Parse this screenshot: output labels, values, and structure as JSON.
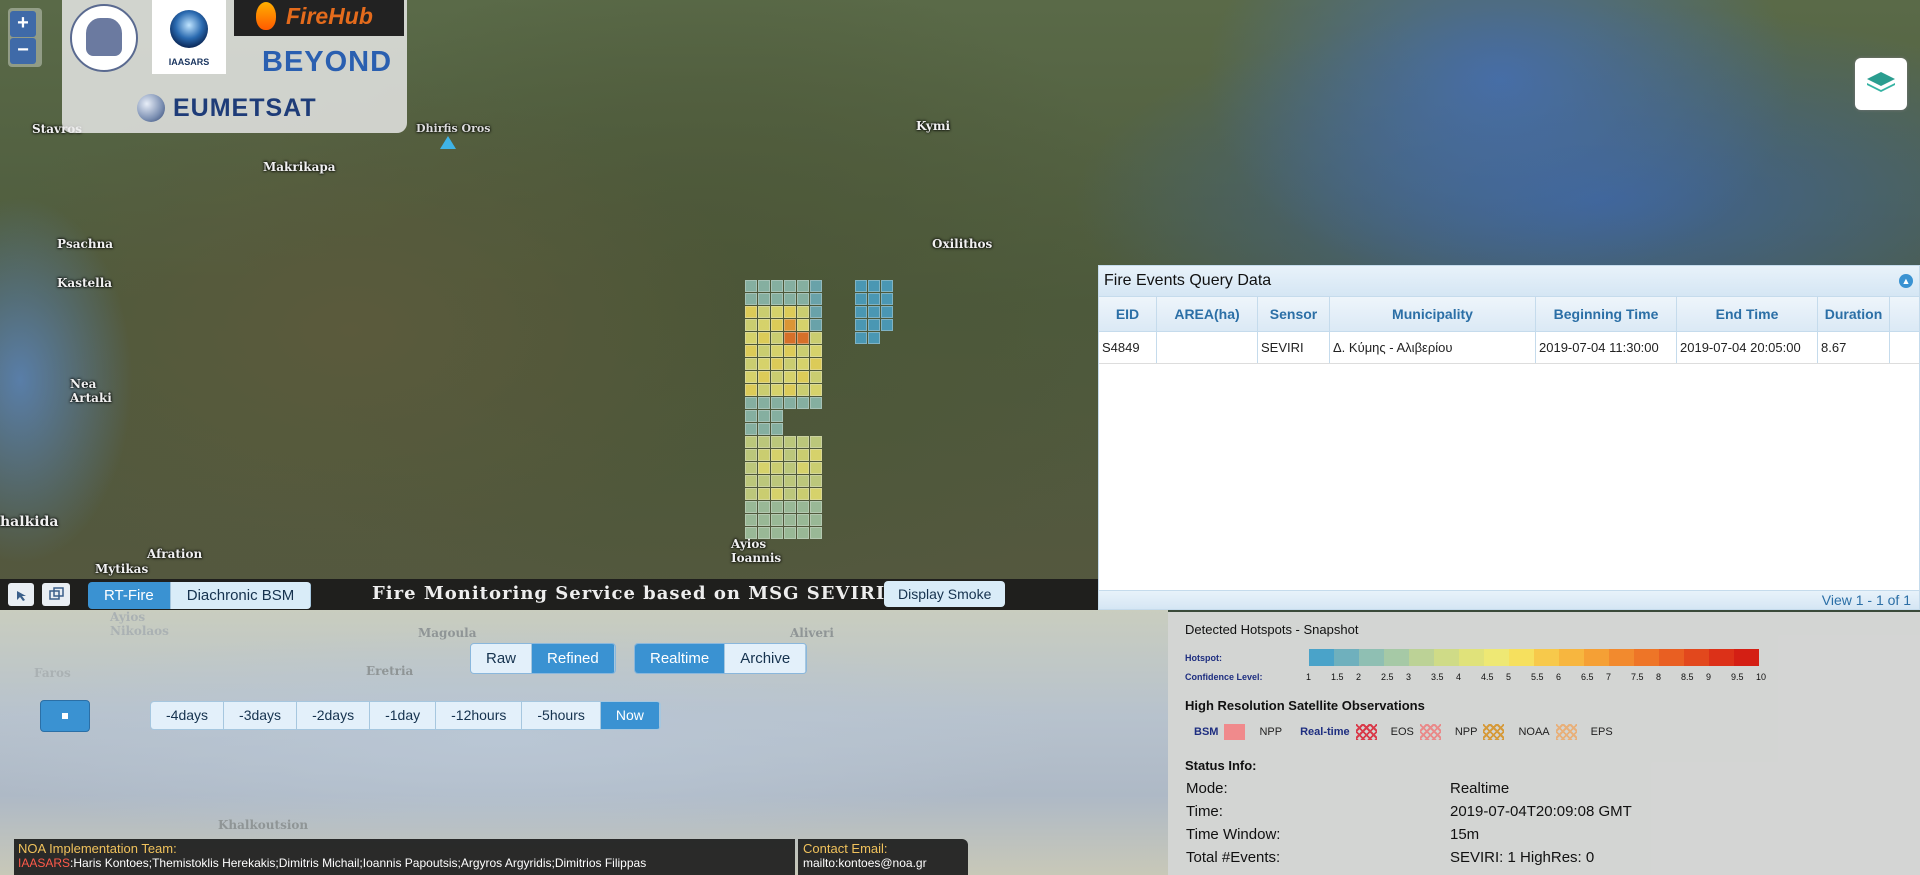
{
  "map": {
    "labels": [
      {
        "id": "stavros",
        "text": "Stavros"
      },
      {
        "id": "dhirfis",
        "text": "Dhirfis Oros"
      },
      {
        "id": "kymi",
        "text": "Kymi"
      },
      {
        "id": "makrikapa",
        "text": "Makrikapa"
      },
      {
        "id": "psachna",
        "text": "Psachna"
      },
      {
        "id": "kastella",
        "text": "Kastella"
      },
      {
        "id": "oxilithos",
        "text": "Oxilithos"
      },
      {
        "id": "nea-artaki",
        "text": "Nea\nArtaki"
      },
      {
        "id": "chalkida",
        "text": "halkida"
      },
      {
        "id": "mytikas",
        "text": "Mytikas"
      },
      {
        "id": "afration",
        "text": "Afration"
      },
      {
        "id": "ayios-ioannis",
        "text": "Ayios\nIoannis"
      }
    ],
    "lower_labels": [
      {
        "id": "ayios-nikolaos",
        "text": "Ayios\nNikolaos"
      },
      {
        "id": "magoula",
        "text": "Magoula"
      },
      {
        "id": "aliveri",
        "text": "Aliveri"
      },
      {
        "id": "eretria",
        "text": "Eretria"
      },
      {
        "id": "faros",
        "text": "Faros"
      },
      {
        "id": "khalkoutsion",
        "text": "Khalkoutsion"
      }
    ],
    "zoom_in": "+",
    "zoom_out": "−"
  },
  "logos": {
    "iaasars": "IAASARS",
    "firehub": "FireHub",
    "beyond": "BEYOND",
    "eumetsat": "EUMETSAT"
  },
  "toolbar": {
    "modes": [
      {
        "label": "RT-Fire",
        "active": true
      },
      {
        "label": "Diachronic BSM",
        "active": false
      }
    ],
    "title": "Fire Monitoring Service based on MSG SEVIRI",
    "smoke_button": "Display Smoke"
  },
  "fire_events": {
    "title": "Fire Events Query Data",
    "columns": [
      "EID",
      "AREA(ha)",
      "Sensor",
      "Municipality",
      "Beginning Time",
      "End Time",
      "Duration"
    ],
    "rows": [
      {
        "eid": "S4849",
        "area": "",
        "sensor": "SEVIRI",
        "municipality": "Δ. Κύμης - Αλιβερίου",
        "begin": "2019-07-04 11:30:00",
        "end": "2019-07-04 20:05:00",
        "duration": "8.67"
      }
    ],
    "footer": "View 1 - 1 of 1"
  },
  "controls": {
    "processing": [
      {
        "label": "Raw",
        "active": false
      },
      {
        "label": "Refined",
        "active": true
      }
    ],
    "mode": [
      {
        "label": "Realtime",
        "active": true
      },
      {
        "label": "Archive",
        "active": false
      }
    ],
    "time_ranges": [
      {
        "label": "-4days",
        "active": false
      },
      {
        "label": "-3days",
        "active": false
      },
      {
        "label": "-2days",
        "active": false
      },
      {
        "label": "-1day",
        "active": false
      },
      {
        "label": "-12hours",
        "active": false
      },
      {
        "label": "-5hours",
        "active": false
      },
      {
        "label": "Now",
        "active": true
      }
    ]
  },
  "team": {
    "title": "NOA Implementation Team:",
    "org": "IAASARS",
    "members": ":Haris Kontoes;Themistoklis Herekakis;Dimitris Michail;Ioannis Papoutsis;Argyros Argyridis;Dimitrios Filippas"
  },
  "contact": {
    "title": "Contact Email:",
    "email": "mailto:kontoes@noa.gr"
  },
  "legend": {
    "snapshot_title": "Detected Hotspots - Snapshot",
    "hotspot_label": "Hotspot:",
    "confidence_label": "Confidence Level:",
    "confidence_ticks": [
      "1",
      "1.5",
      "2",
      "2.5",
      "3",
      "3.5",
      "4",
      "4.5",
      "5",
      "5.5",
      "6",
      "6.5",
      "7",
      "7.5",
      "8",
      "8.5",
      "9",
      "9.5",
      "10"
    ],
    "colors": [
      "#4aa3c9",
      "#6fb0bd",
      "#8fbfb3",
      "#a6c9a6",
      "#bcd296",
      "#cfdb87",
      "#e0e27a",
      "#eee874",
      "#f6e05e",
      "#f7c94b",
      "#f7b63f",
      "#f5a035",
      "#f28a2e",
      "#ee7527",
      "#e95f22",
      "#e2481d",
      "#dc3118",
      "#d41f14"
    ],
    "highres_title": "High Resolution Satellite Observations",
    "highres_items": [
      {
        "label": "BSM",
        "color": "#f08a8c"
      },
      {
        "label": "NPP",
        "color": ""
      },
      {
        "label": "Real-time",
        "color": "#d93b4a"
      },
      {
        "label": "EOS",
        "color": "#e98a8a"
      },
      {
        "label": "NPP",
        "color": "#d69a3a"
      },
      {
        "label": "NOAA",
        "color": "#e8b07a"
      },
      {
        "label": "EPS",
        "color": ""
      }
    ],
    "status_title": "Status Info:",
    "status": [
      {
        "label": "Mode:",
        "value": "Realtime"
      },
      {
        "label": "Time:",
        "value": "2019-07-04T20:09:08 GMT"
      },
      {
        "label": "Time Window:",
        "value": "15m"
      },
      {
        "label": "Total #Events:",
        "value": "SEVIRI: 1  HighRes: 0"
      }
    ]
  }
}
